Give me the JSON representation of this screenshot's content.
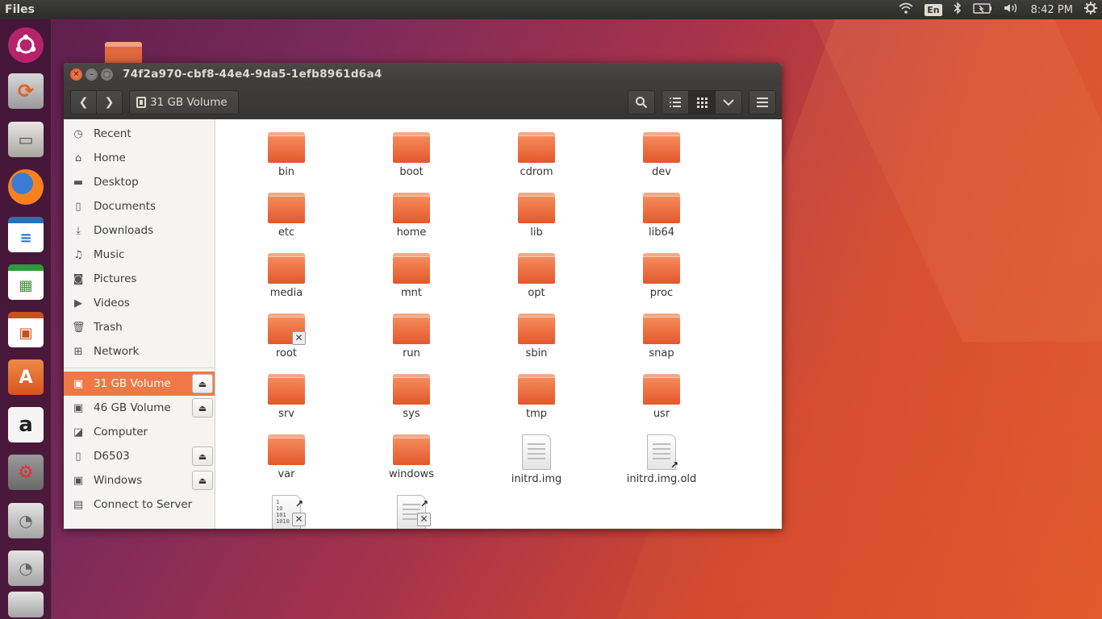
{
  "top_panel": {
    "app_name": "Files",
    "lang": "En",
    "time": "8:42 PM"
  },
  "launcher": {
    "items": [
      "ubuntu-logo-icon",
      "software-updater-icon",
      "files-icon",
      "firefox-icon",
      "writer-icon",
      "calc-icon",
      "impress-icon",
      "software-center-icon",
      "amazon-icon",
      "settings-icon",
      "drive-icon",
      "drive-icon",
      "drive-icon"
    ]
  },
  "window": {
    "title": "74f2a970-cbf8-44e4-9da5-1efb8961d6a4",
    "location": "31 GB Volume"
  },
  "sidebar": {
    "places": [
      {
        "label": "Recent",
        "icon": "clock-icon"
      },
      {
        "label": "Home",
        "icon": "home-icon"
      },
      {
        "label": "Desktop",
        "icon": "desktop-icon"
      },
      {
        "label": "Documents",
        "icon": "documents-icon"
      },
      {
        "label": "Downloads",
        "icon": "downloads-icon"
      },
      {
        "label": "Music",
        "icon": "music-icon"
      },
      {
        "label": "Pictures",
        "icon": "camera-icon"
      },
      {
        "label": "Videos",
        "icon": "video-icon"
      },
      {
        "label": "Trash",
        "icon": "trash-icon"
      },
      {
        "label": "Network",
        "icon": "network-icon"
      }
    ],
    "devices": [
      {
        "label": "31 GB Volume",
        "eject": true,
        "active": true
      },
      {
        "label": "46 GB Volume",
        "eject": true,
        "active": false
      },
      {
        "label": "Computer",
        "eject": false,
        "active": false
      },
      {
        "label": "D6503",
        "eject": true,
        "active": false
      },
      {
        "label": "Windows",
        "eject": true,
        "active": false
      },
      {
        "label": "Connect to Server",
        "eject": false,
        "active": false
      }
    ]
  },
  "files": [
    {
      "name": "bin",
      "type": "folder"
    },
    {
      "name": "boot",
      "type": "folder"
    },
    {
      "name": "cdrom",
      "type": "folder"
    },
    {
      "name": "dev",
      "type": "folder"
    },
    {
      "name": "etc",
      "type": "folder"
    },
    {
      "name": "home",
      "type": "folder"
    },
    {
      "name": "lib",
      "type": "folder"
    },
    {
      "name": "lib64",
      "type": "folder"
    },
    {
      "name": "media",
      "type": "folder"
    },
    {
      "name": "mnt",
      "type": "folder"
    },
    {
      "name": "opt",
      "type": "folder"
    },
    {
      "name": "proc",
      "type": "folder"
    },
    {
      "name": "root",
      "type": "folder",
      "emblem": "x"
    },
    {
      "name": "run",
      "type": "folder"
    },
    {
      "name": "sbin",
      "type": "folder"
    },
    {
      "name": "snap",
      "type": "folder"
    },
    {
      "name": "srv",
      "type": "folder"
    },
    {
      "name": "sys",
      "type": "folder"
    },
    {
      "name": "tmp",
      "type": "folder"
    },
    {
      "name": "usr",
      "type": "folder"
    },
    {
      "name": "var",
      "type": "folder"
    },
    {
      "name": "windows",
      "type": "folder"
    },
    {
      "name": "initrd.img",
      "type": "doc"
    },
    {
      "name": "initrd.img.old",
      "type": "doc",
      "emblem": "link"
    },
    {
      "name": "",
      "type": "binary",
      "emblem": "x-link"
    },
    {
      "name": "",
      "type": "doc",
      "emblem": "x-link"
    }
  ]
}
